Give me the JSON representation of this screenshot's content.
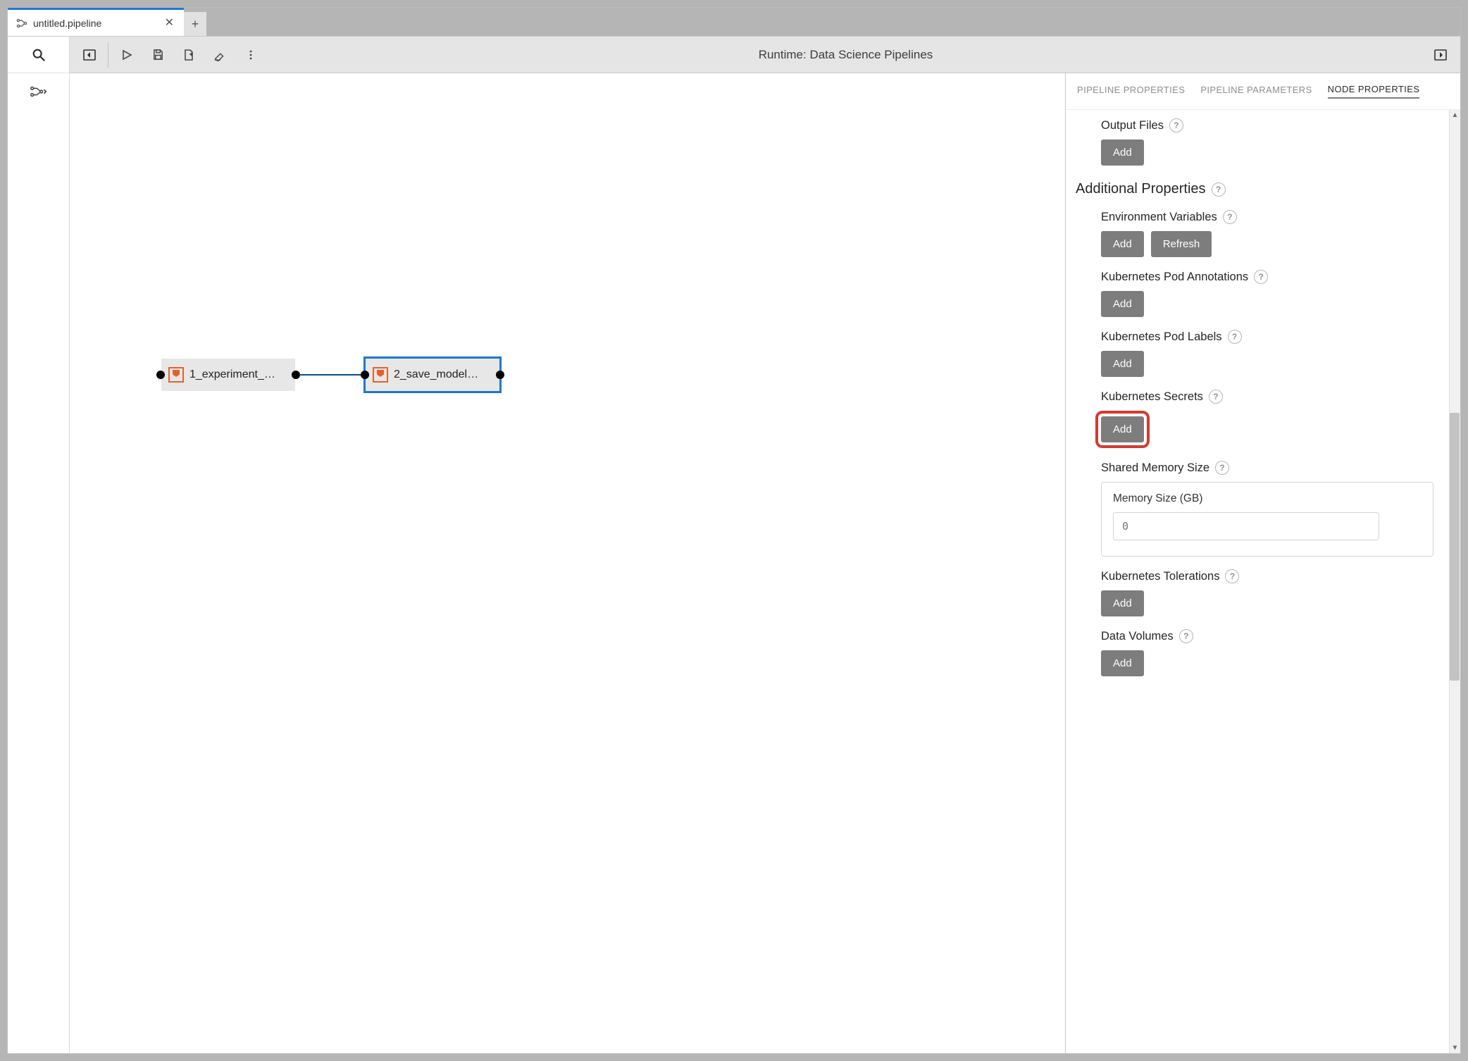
{
  "tab": {
    "title": "untitled.pipeline"
  },
  "toolbar": {
    "runtime_label": "Runtime: Data Science Pipelines"
  },
  "canvas": {
    "nodes": [
      {
        "label": "1_experiment_…"
      },
      {
        "label": "2_save_model…"
      }
    ]
  },
  "right_panel": {
    "tabs": {
      "pipeline_properties": "PIPELINE PROPERTIES",
      "pipeline_parameters": "PIPELINE PARAMETERS",
      "node_properties": "NODE PROPERTIES"
    },
    "output_files": {
      "label": "Output Files",
      "add": "Add"
    },
    "additional_properties_header": "Additional Properties",
    "env_vars": {
      "label": "Environment Variables",
      "add": "Add",
      "refresh": "Refresh"
    },
    "pod_annotations": {
      "label": "Kubernetes Pod Annotations",
      "add": "Add"
    },
    "pod_labels": {
      "label": "Kubernetes Pod Labels",
      "add": "Add"
    },
    "secrets": {
      "label": "Kubernetes Secrets",
      "add": "Add"
    },
    "shared_memory": {
      "label": "Shared Memory Size",
      "sublabel": "Memory Size (GB)",
      "placeholder": "0"
    },
    "tolerations": {
      "label": "Kubernetes Tolerations",
      "add": "Add"
    },
    "data_volumes": {
      "label": "Data Volumes",
      "add": "Add"
    }
  }
}
